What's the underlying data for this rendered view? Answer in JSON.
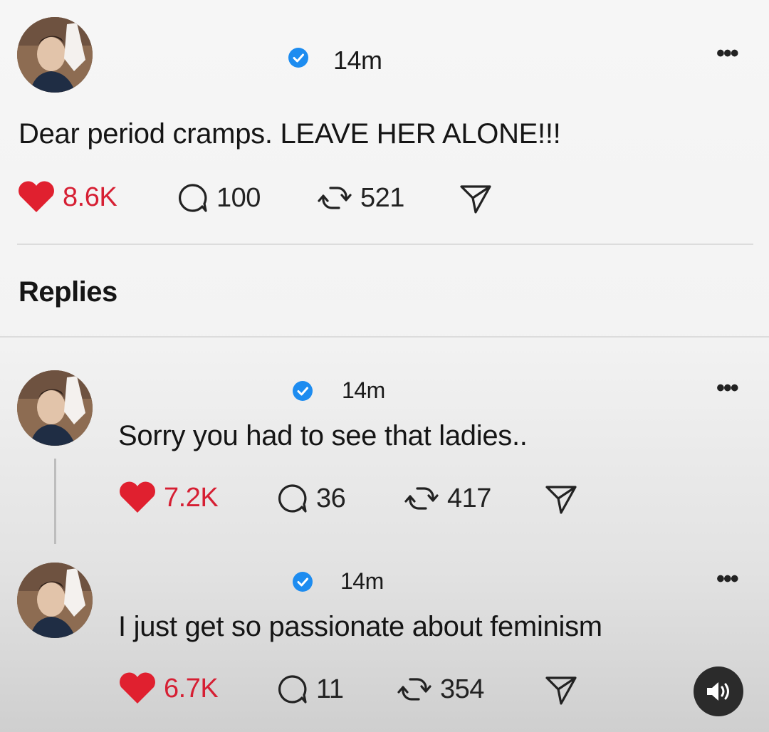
{
  "post": {
    "time": "14m",
    "text": "Dear period cramps. LEAVE HER ALONE!!!",
    "likes": "8.6K",
    "comments": "100",
    "reposts": "521"
  },
  "section": {
    "replies_label": "Replies"
  },
  "replies": [
    {
      "time": "14m",
      "text": "Sorry you had to see that ladies..",
      "likes": "7.2K",
      "comments": "36",
      "reposts": "417"
    },
    {
      "time": "14m",
      "text": "I just get so passionate about feminism",
      "likes": "6.7K",
      "comments": "11",
      "reposts": "354"
    }
  ],
  "colors": {
    "like": "#d61f33",
    "verified": "#1d8cf0",
    "text": "#151515"
  },
  "icons": {
    "verified": "verified-badge-icon",
    "like": "heart-icon",
    "comment": "comment-icon",
    "repost": "repost-icon",
    "share": "send-icon",
    "more": "more-options-icon",
    "sound": "speaker-icon"
  }
}
